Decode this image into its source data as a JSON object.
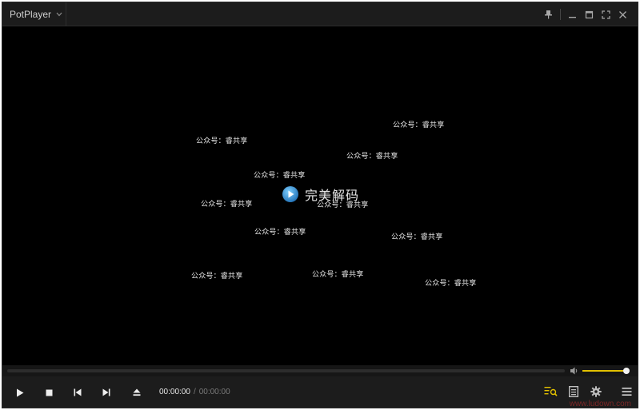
{
  "app": {
    "title": "PotPlayer"
  },
  "icons": {
    "menu": "chevron-down-icon",
    "pin": "pin-icon",
    "minimize": "minimize-icon",
    "maximize": "maximize-icon",
    "fullscreen": "fullscreen-icon",
    "close": "close-icon",
    "volume": "speaker-icon",
    "play": "play-icon",
    "stop": "stop-icon",
    "prev": "previous-icon",
    "next": "next-icon",
    "eject": "eject-icon",
    "search_playlist": "playlist-search-icon",
    "chapters": "chapter-list-icon",
    "settings": "gear-icon",
    "main_menu": "hamburger-menu-icon"
  },
  "video": {
    "logo_text": "完美解码",
    "watermarks": [
      "公众号：睿共享",
      "公众号：睿共享",
      "公众号：睿共享",
      "公众号：睿共享",
      "公众号：睿共享",
      "公众号：睿共享",
      "公众号：睿共享",
      "公众号：睿共享",
      "公众号：睿共享",
      "公众号：睿共享",
      "公众号：睿共享"
    ]
  },
  "playback": {
    "current_time": "00:00:00",
    "separator": "/",
    "total_time": "00:00:00",
    "progress": 0.0,
    "volume_level": 0.95
  },
  "footer": {
    "credit": "www.ludown.com"
  },
  "colors": {
    "accent": "#e2c000",
    "background": "#000000",
    "bar": "#1c1c1c"
  }
}
